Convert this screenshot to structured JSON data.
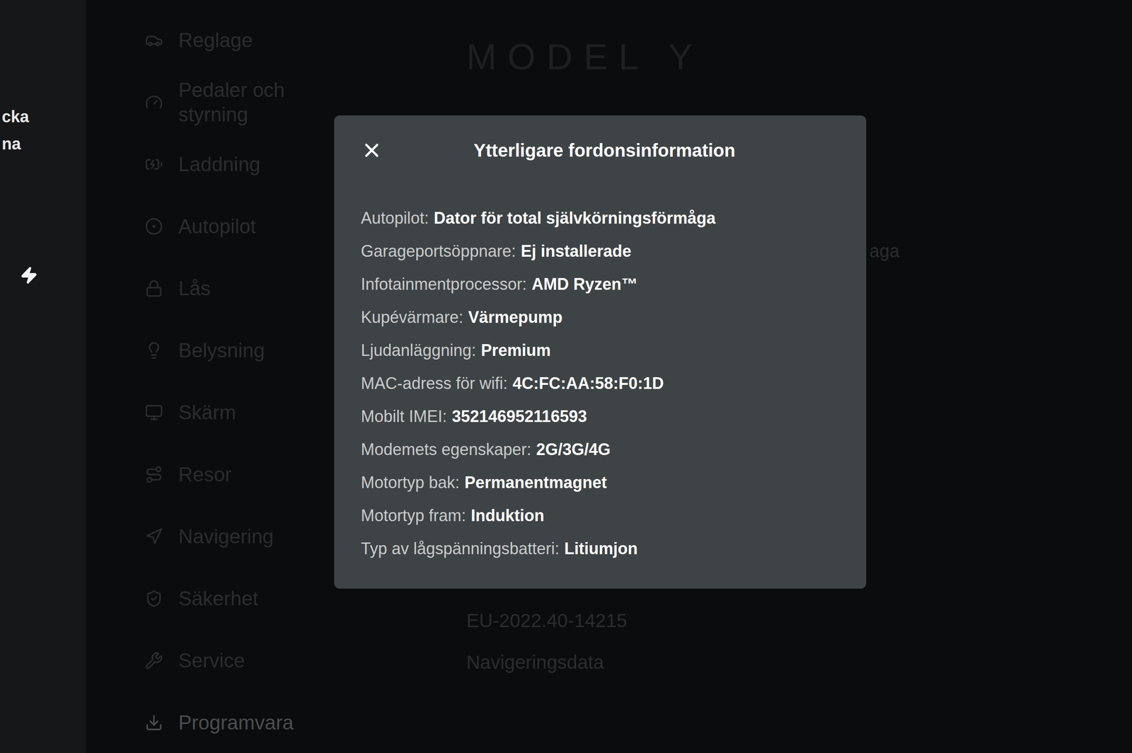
{
  "background": {
    "edge_texts": [
      "cka",
      "na"
    ],
    "sidebar": {
      "items": [
        {
          "label": "Reglage",
          "selected": false
        },
        {
          "label": "Pedaler och styrning",
          "selected": false
        },
        {
          "label": "Laddning",
          "selected": false
        },
        {
          "label": "Autopilot",
          "selected": false
        },
        {
          "label": "Lås",
          "selected": false
        },
        {
          "label": "Belysning",
          "selected": false
        },
        {
          "label": "Skärm",
          "selected": false
        },
        {
          "label": "Resor",
          "selected": false
        },
        {
          "label": "Navigering",
          "selected": false
        },
        {
          "label": "Säkerhet",
          "selected": false
        },
        {
          "label": "Service",
          "selected": false
        },
        {
          "label": "Programvara",
          "selected": true
        }
      ]
    },
    "main": {
      "logo": "MODEL Y",
      "partial_text": "aga",
      "software_version": "EU-2022.40-14215",
      "link": "Navigeringsdata"
    }
  },
  "dialog": {
    "title": "Ytterligare fordonsinformation",
    "rows": [
      {
        "label": "Autopilot:",
        "value": "Dator för total självkörningsförmåga"
      },
      {
        "label": "Garageportsöppnare:",
        "value": "Ej installerade"
      },
      {
        "label": "Infotainmentprocessor:",
        "value": "AMD Ryzen™"
      },
      {
        "label": "Kupévärmare:",
        "value": "Värmepump"
      },
      {
        "label": "Ljudanläggning:",
        "value": "Premium"
      },
      {
        "label": "MAC-adress för wifi:",
        "value": "4C:FC:AA:58:F0:1D"
      },
      {
        "label": "Mobilt IMEI:",
        "value": "352146952116593"
      },
      {
        "label": "Modemets egenskaper:",
        "value": "2G/3G/4G"
      },
      {
        "label": "Motortyp bak:",
        "value": "Permanentmagnet"
      },
      {
        "label": "Motortyp fram:",
        "value": "Induktion"
      },
      {
        "label": "Typ av lågspänningsbatteri:",
        "value": "Litiumjon"
      }
    ]
  }
}
